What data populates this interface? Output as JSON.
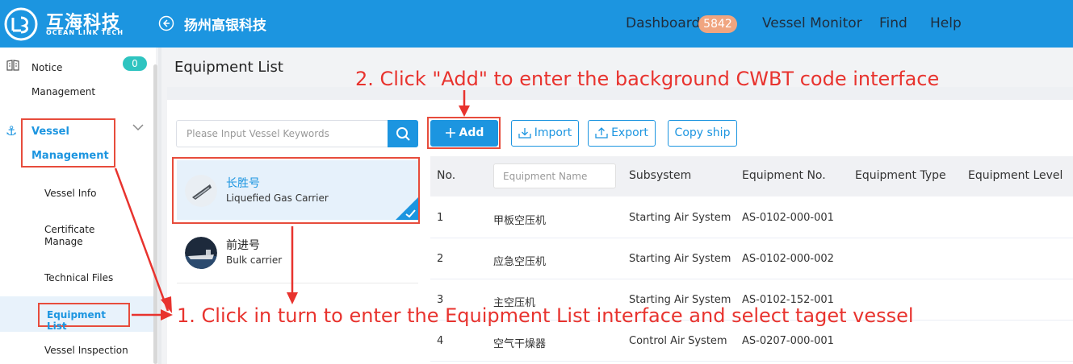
{
  "header": {
    "logo_cn": "互海科技",
    "logo_en": "OCEAN LINK TECH",
    "company": "扬州高银科技",
    "nav": {
      "dashboard": "Dashboard",
      "dashboard_badge": "5842",
      "vessel_monitor": "Vessel Monitor",
      "find": "Find",
      "help": "Help"
    }
  },
  "sidebar": {
    "notice_line1": "Notice",
    "notice_line2": "Management",
    "notice_badge": "0",
    "vessel_line1": "Vessel",
    "vessel_line2": "Management",
    "items": {
      "vessel_info": "Vessel Info",
      "certificate_line1": "Certificate",
      "certificate_line2": "Manage",
      "technical_files": "Technical Files",
      "equipment_list": "Equipment List",
      "vessel_inspection": "Vessel Inspection"
    }
  },
  "main": {
    "title": "Equipment List",
    "search_placeholder": "Please Input Vessel Keywords",
    "vessels": [
      {
        "name": "长胜号",
        "type": "Liquefied Gas Carrier"
      },
      {
        "name": "前进号",
        "type": "Bulk carrier"
      }
    ],
    "toolbar": {
      "add": "Add",
      "import": "Import",
      "export": "Export",
      "copy_ship": "Copy ship"
    },
    "table": {
      "headers": {
        "no": "No.",
        "name_placeholder": "Equipment Name",
        "subsystem": "Subsystem",
        "equipment_no": "Equipment No.",
        "equipment_type": "Equipment Type",
        "equipment_level": "Equipment Level"
      },
      "rows": [
        {
          "no": "1",
          "name": "甲板空压机",
          "subsystem": "Starting Air System",
          "equipment_no": "AS-0102-000-001"
        },
        {
          "no": "2",
          "name": "应急空压机",
          "subsystem": "Starting Air System",
          "equipment_no": "AS-0102-000-002"
        },
        {
          "no": "3",
          "name": "主空压机",
          "subsystem": "Starting Air System",
          "equipment_no": "AS-0102-152-001"
        },
        {
          "no": "4",
          "name": "空气干燥器",
          "subsystem": "Control Air System",
          "equipment_no": "AS-0207-000-001"
        }
      ]
    }
  },
  "annotations": {
    "step1": "1. Click in turn to enter the Equipment List interface and select taget vessel",
    "step2": "2. Click \"Add\" to enter the background CWBT code interface"
  },
  "colors": {
    "primary": "#1c95e0",
    "annotation": "#e8332e",
    "badge": "#f0a580",
    "teal_badge": "#2ec4c0"
  }
}
